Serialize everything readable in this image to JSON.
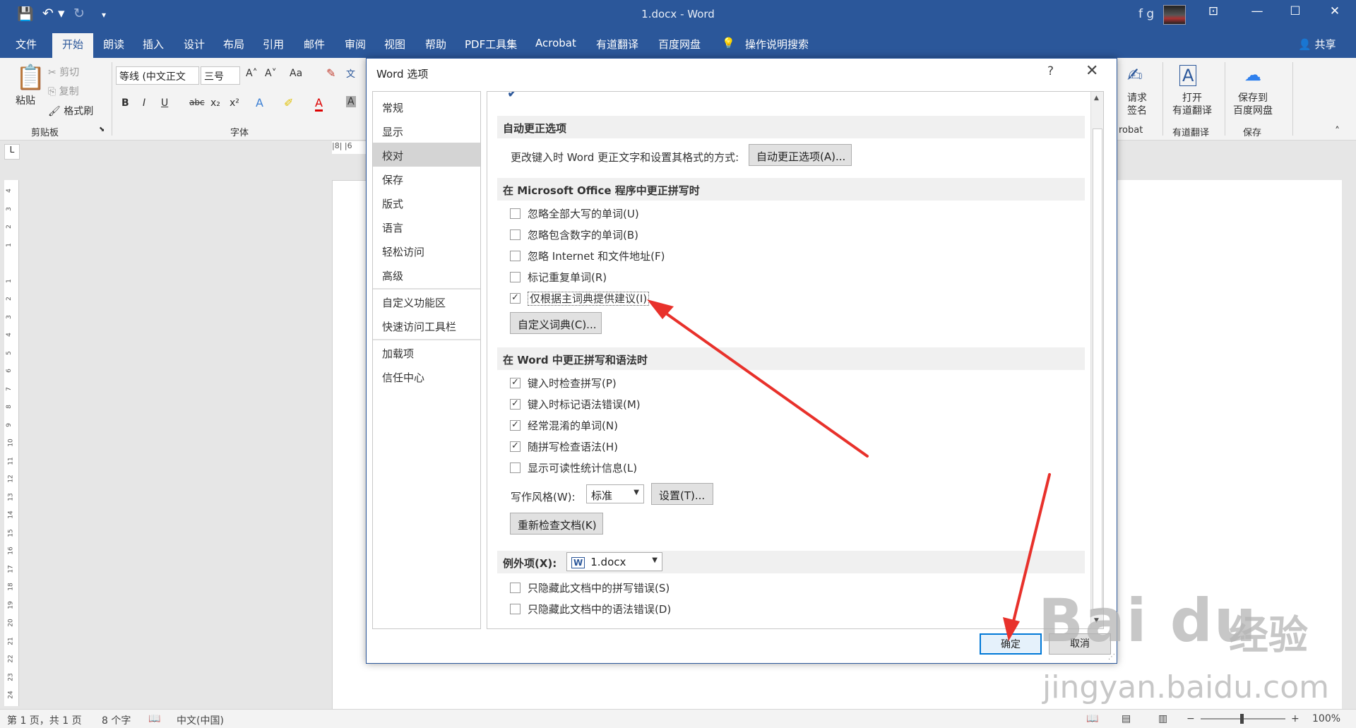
{
  "window": {
    "title": "1.docx - Word",
    "user": "f g",
    "qa_save": "💾",
    "qa_undo": "↶ ▾",
    "qa_redo": "↻",
    "qa_more": "▾"
  },
  "menu": {
    "items": [
      "文件",
      "开始",
      "朗读",
      "插入",
      "设计",
      "布局",
      "引用",
      "邮件",
      "审阅",
      "视图",
      "帮助",
      "PDF工具集",
      "Acrobat",
      "有道翻译",
      "百度网盘"
    ],
    "search": "操作说明搜索",
    "share": "共享"
  },
  "ribbon": {
    "paste": "粘贴",
    "cut": "剪切",
    "copy": "复制",
    "format_painter": "格式刷",
    "clipboard_group": "剪贴板",
    "font_name": "等线 (中文正文",
    "font_size": "三号",
    "font_group": "字体",
    "bold": "B",
    "italic": "I",
    "underline": "U",
    "strike": "abc",
    "sub": "x₂",
    "sup": "x²",
    "grow": "A˄",
    "shrink": "A˅",
    "case": "Aa",
    "request_sign": "请求\n签名",
    "acrobat_group": "robat",
    "open_youdao": "打开\n有道翻译",
    "youdao_group": "有道翻译",
    "save_baidu": "保存到\n百度网盘",
    "save_group": "保存"
  },
  "dialog": {
    "title": "Word 选项",
    "help": "?",
    "close": "✕",
    "nav": [
      "常规",
      "显示",
      "校对",
      "保存",
      "版式",
      "语言",
      "轻松访问",
      "高级",
      "自定义功能区",
      "快速访问工具栏",
      "加载项",
      "信任中心"
    ],
    "active_nav": "校对",
    "sections": {
      "autocorrect": "自动更正选项",
      "office": "在 Microsoft Office 程序中更正拼写时",
      "word": "在 Word 中更正拼写和语法时",
      "exceptions": "例外项(X):"
    },
    "autocorrect_label": "更改键入时 Word 更正文字和设置其格式的方式:",
    "autocorrect_button": "自动更正选项(A)...",
    "office_checks": [
      {
        "label": "忽略全部大写的单词(U)",
        "checked": false
      },
      {
        "label": "忽略包含数字的单词(B)",
        "checked": false
      },
      {
        "label": "忽略 Internet 和文件地址(F)",
        "checked": false
      },
      {
        "label": "标记重复单词(R)",
        "checked": false
      },
      {
        "label": "仅根据主词典提供建议(I)",
        "checked": true
      }
    ],
    "custom_dict_button": "自定义词典(C)...",
    "word_checks": [
      {
        "label": "键入时检查拼写(P)",
        "checked": true
      },
      {
        "label": "键入时标记语法错误(M)",
        "checked": true
      },
      {
        "label": "经常混淆的单词(N)",
        "checked": true
      },
      {
        "label": "随拼写检查语法(H)",
        "checked": true
      },
      {
        "label": "显示可读性统计信息(L)",
        "checked": false
      }
    ],
    "writing_style_label": "写作风格(W):",
    "writing_style_value": "标准",
    "settings_button": "设置(T)...",
    "recheck_button": "重新检查文档(K)",
    "exceptions_file": "1.docx",
    "exception_checks": [
      {
        "label": "只隐藏此文档中的拼写错误(S)",
        "checked": false
      },
      {
        "label": "只隐藏此文档中的语法错误(D)",
        "checked": false
      }
    ],
    "ok": "确定",
    "cancel": "取消"
  },
  "ruler": {
    "h": "|8|  |6",
    "v": [
      "4",
      "3",
      "2",
      "1",
      "",
      "1",
      "2",
      "3",
      "4",
      "5",
      "6",
      "7",
      "8",
      "9",
      "10",
      "11",
      "12",
      "13",
      "14",
      "15",
      "16",
      "17",
      "18",
      "19",
      "20",
      "21",
      "22",
      "23",
      "24"
    ]
  },
  "status": {
    "page": "第 1 页，共 1 页",
    "words": "8 个字",
    "lang": "中文(中国)",
    "zoom": "100%"
  },
  "watermark": {
    "brand": "Bai du",
    "cn": "经验",
    "url": "jingyan.baidu.com"
  },
  "colors": {
    "accent": "#2b579a",
    "arrow": "#e8312b"
  }
}
